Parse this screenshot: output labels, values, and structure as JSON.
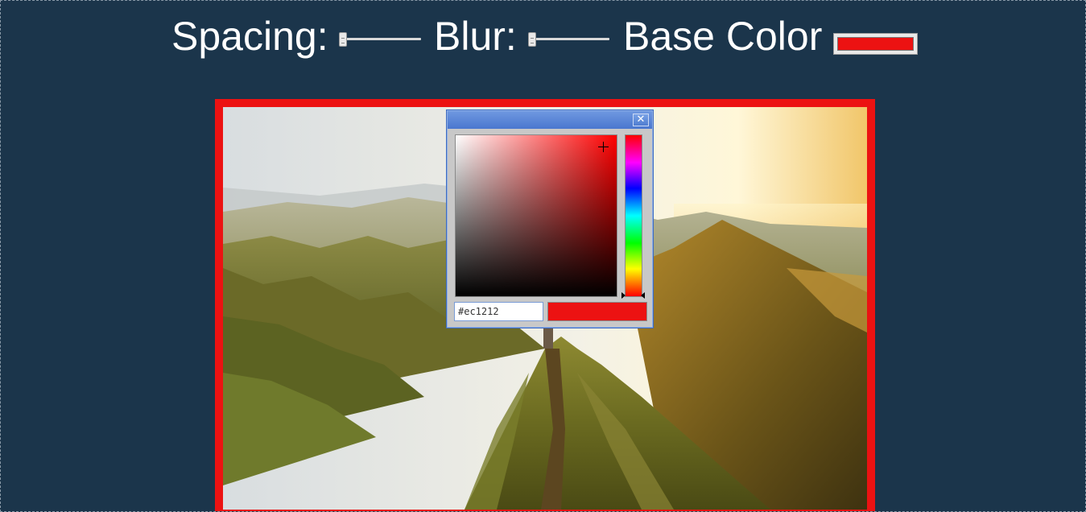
{
  "controls": {
    "spacing_label": "Spacing:",
    "blur_label": "Blur:",
    "base_color_label": "Base Color"
  },
  "spacing_slider": {
    "value_fraction": 0.0
  },
  "blur_slider": {
    "value_fraction": 0.0
  },
  "base_color": "#ec1212",
  "photo": {
    "description_icon": "mountain-ridge-photo"
  },
  "color_picker": {
    "close_glyph": "✕",
    "hex_value": "#ec1212",
    "preview_color": "#ec1212",
    "hue_color": "#ff0000"
  },
  "colors": {
    "background": "#1b354b",
    "frame_border": "#ec1212",
    "titlebar": "#5b86d8"
  }
}
